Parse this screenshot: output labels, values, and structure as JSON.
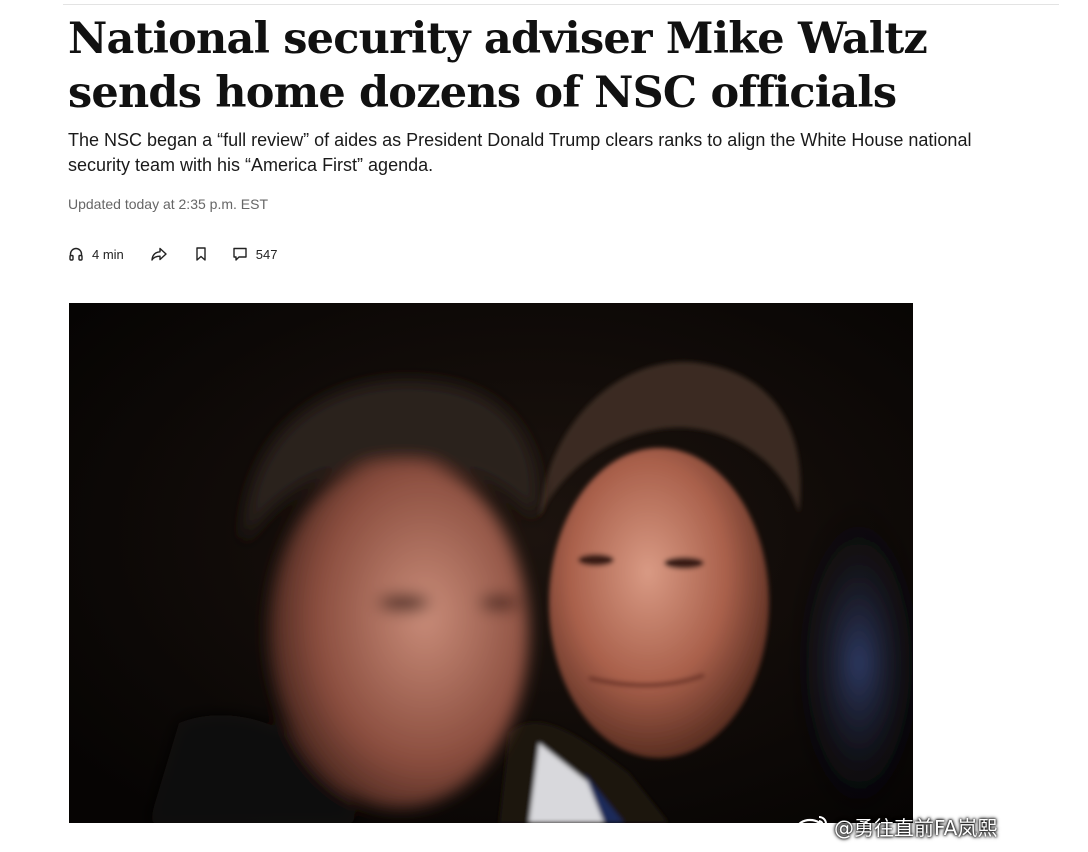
{
  "article": {
    "headline": "National security adviser Mike Waltz sends home dozens of NSC officials",
    "dek": "The NSC began a “full review” of aides as President Donald Trump clears ranks to align the White House national security team with his “America First” agenda.",
    "timestamp": "Updated today at 2:35 p.m. EST"
  },
  "toolbar": {
    "listen_label": "4 min",
    "listen_icon": "headphones-icon",
    "share_icon": "share-arrow-icon",
    "save_icon": "bookmark-icon",
    "comments_icon": "comment-icon",
    "comments_count": "547"
  },
  "watermark": {
    "icon": "weibo-logo",
    "text": "@勇往直前FA岚熙"
  },
  "colors": {
    "headline": "#111111",
    "dek": "#1a1a1a",
    "timestamp": "#666666",
    "photo_background": "#0b0705"
  }
}
